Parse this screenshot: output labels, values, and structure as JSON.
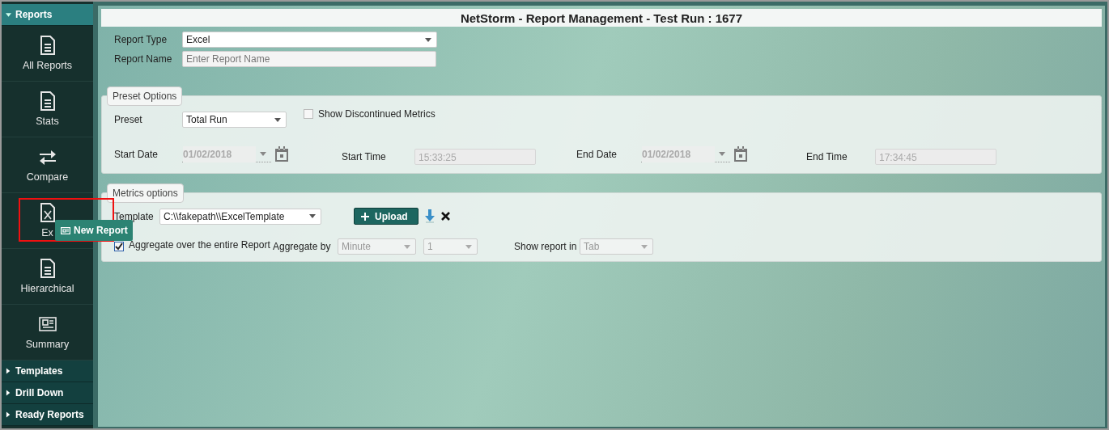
{
  "sidebar": {
    "sections": [
      {
        "label": "Reports",
        "expanded": true,
        "items": [
          {
            "label": "All Reports",
            "kind": "document"
          },
          {
            "label": "Stats",
            "kind": "document"
          },
          {
            "label": "Compare",
            "kind": "arrows"
          },
          {
            "label": "Ex",
            "kind": "spreadsheet"
          },
          {
            "label": "Hierarchical",
            "kind": "document"
          },
          {
            "label": "Summary",
            "kind": "newspaper"
          }
        ]
      },
      {
        "label": "Templates",
        "expanded": false
      },
      {
        "label": "Drill Down",
        "expanded": false
      },
      {
        "label": "Ready Reports",
        "expanded": false
      }
    ]
  },
  "popup": {
    "label": "New Report"
  },
  "window": {
    "title": "NetStorm - Report Management - Test Run : 1677"
  },
  "report_type": {
    "label": "Report Type",
    "value": "Excel"
  },
  "report_name": {
    "label": "Report Name",
    "placeholder": "Enter Report Name"
  },
  "preset_options": {
    "legend": "Preset Options",
    "preset": {
      "label": "Preset",
      "value": "Total Run"
    },
    "show_discontinued": {
      "label": "Show Discontinued Metrics",
      "checked": false
    },
    "start_date": {
      "label": "Start Date",
      "value": "01/02/2018",
      "disabled": true
    },
    "start_time": {
      "label": "Start Time",
      "value": "15:33:25",
      "disabled": true
    },
    "end_date": {
      "label": "End Date",
      "value": "01/02/2018",
      "disabled": true
    },
    "end_time": {
      "label": "End Time",
      "value": "17:34:45",
      "disabled": true
    }
  },
  "metrics_options": {
    "legend": "Metrics options",
    "template": {
      "label": "Template",
      "value": "C:\\\\fakepath\\\\ExcelTemplate"
    },
    "upload_button": {
      "label": "Upload"
    },
    "aggregate_entire": {
      "label": "Aggregate over the entire Report",
      "checked": true
    },
    "aggregate_by": {
      "label": "Aggregate by",
      "unit": "Minute",
      "count": "1"
    },
    "show_report_in": {
      "label": "Show report in",
      "value": "Tab"
    }
  }
}
